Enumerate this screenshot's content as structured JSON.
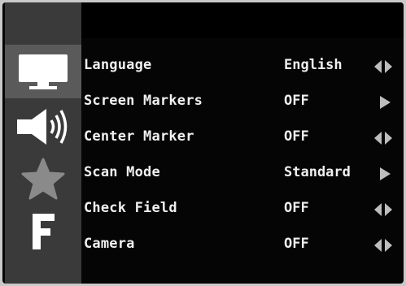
{
  "sidebar": {
    "items": [
      {
        "icon": "monitor-icon",
        "active": true
      },
      {
        "icon": "speaker-icon",
        "active": false
      },
      {
        "icon": "star-icon",
        "active": false
      },
      {
        "icon": "letter-f-icon",
        "glyph": "F",
        "active": false
      }
    ]
  },
  "menu": {
    "rows": [
      {
        "label": "Language",
        "value": "English",
        "arrows": "both"
      },
      {
        "label": "Screen Markers",
        "value": "OFF",
        "arrows": "right"
      },
      {
        "label": "Center Marker",
        "value": "OFF",
        "arrows": "both"
      },
      {
        "label": "Scan Mode",
        "value": "Standard",
        "arrows": "right"
      },
      {
        "label": "Check Field",
        "value": "OFF",
        "arrows": "both"
      },
      {
        "label": "Camera",
        "value": "OFF",
        "arrows": "both"
      }
    ]
  },
  "colors": {
    "background": "#050505",
    "sidebar": "#3a3a3a",
    "sidebar_active": "#5a5a5a",
    "text": "#f0f0f0",
    "arrow": "#bdbdbd"
  }
}
